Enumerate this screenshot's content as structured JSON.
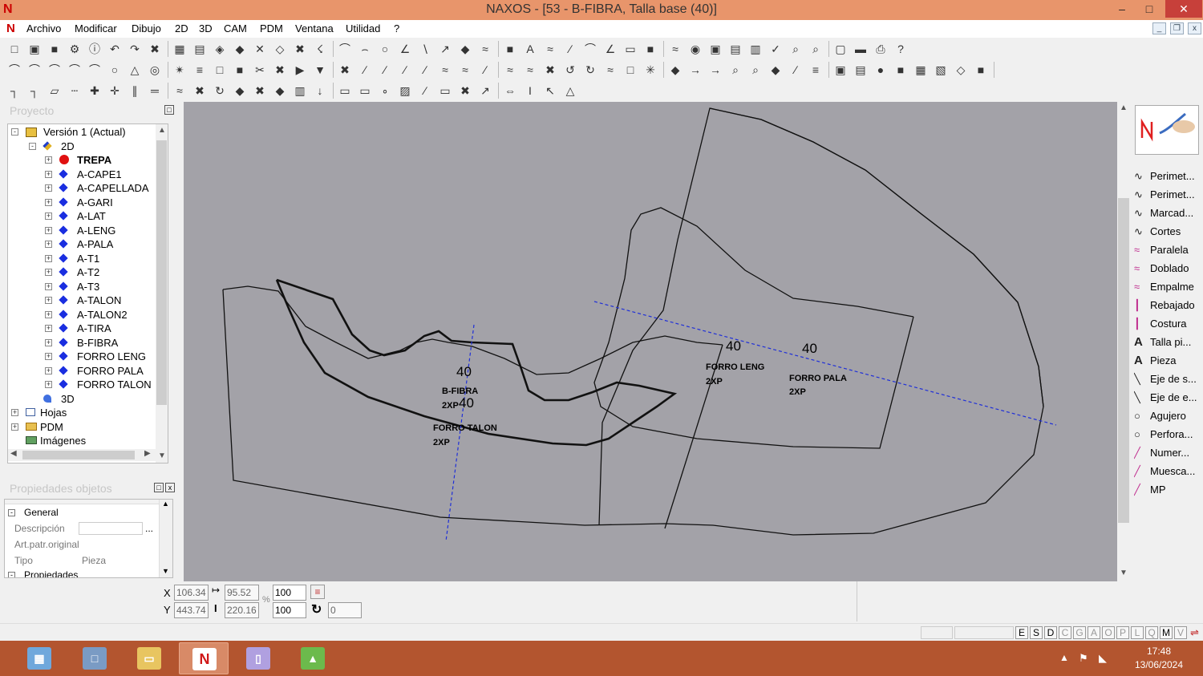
{
  "window": {
    "title": "NAXOS - [53 - B-FIBRA, Talla base (40)]",
    "minimize": "–",
    "maximize": "□",
    "close": "✕"
  },
  "menu": [
    "Archivo",
    "Modificar",
    "Dibujo",
    "2D",
    "3D",
    "CAM",
    "PDM",
    "Ventana",
    "Utilidad",
    "?"
  ],
  "project_panel": {
    "header": "Proyecto",
    "tree": [
      {
        "label": "Versión 1 (Actual)",
        "icon": "version-icon",
        "level": 0,
        "expander": "minus"
      },
      {
        "label": "2D",
        "icon": "2d-icon",
        "level": 1,
        "expander": "minus"
      },
      {
        "label": "TREPA",
        "icon": "red-dot",
        "level": 2,
        "expander": "plus",
        "bold": true
      },
      {
        "label": "A-CAPE1",
        "icon": "blue-diamond",
        "level": 2,
        "expander": "plus"
      },
      {
        "label": "A-CAPELLADA",
        "icon": "blue-diamond",
        "level": 2,
        "expander": "plus"
      },
      {
        "label": "A-GARI",
        "icon": "blue-diamond",
        "level": 2,
        "expander": "plus"
      },
      {
        "label": "A-LAT",
        "icon": "blue-diamond",
        "level": 2,
        "expander": "plus"
      },
      {
        "label": "A-LENG",
        "icon": "blue-diamond",
        "level": 2,
        "expander": "plus"
      },
      {
        "label": "A-PALA",
        "icon": "blue-diamond",
        "level": 2,
        "expander": "plus"
      },
      {
        "label": "A-T1",
        "icon": "blue-diamond",
        "level": 2,
        "expander": "plus"
      },
      {
        "label": "A-T2",
        "icon": "blue-diamond",
        "level": 2,
        "expander": "plus"
      },
      {
        "label": "A-T3",
        "icon": "blue-diamond",
        "level": 2,
        "expander": "plus"
      },
      {
        "label": "A-TALON",
        "icon": "blue-diamond",
        "level": 2,
        "expander": "plus"
      },
      {
        "label": "A-TALON2",
        "icon": "blue-diamond",
        "level": 2,
        "expander": "plus"
      },
      {
        "label": "A-TIRA",
        "icon": "blue-diamond",
        "level": 2,
        "expander": "plus"
      },
      {
        "label": "B-FIBRA",
        "icon": "blue-diamond",
        "level": 2,
        "expander": "plus"
      },
      {
        "label": "FORRO LENG",
        "icon": "blue-diamond",
        "level": 2,
        "expander": "plus"
      },
      {
        "label": "FORRO PALA",
        "icon": "blue-diamond",
        "level": 2,
        "expander": "plus"
      },
      {
        "label": "FORRO TALON",
        "icon": "blue-diamond",
        "level": 2,
        "expander": "plus"
      },
      {
        "label": "3D",
        "icon": "3d-icon",
        "level": 1,
        "expander": "none"
      },
      {
        "label": "Hojas",
        "icon": "sheets-icon",
        "level": 0,
        "expander": "plus"
      },
      {
        "label": "PDM",
        "icon": "folder-icon",
        "level": 0,
        "expander": "plus"
      },
      {
        "label": "Imágenes",
        "icon": "images-icon",
        "level": 0,
        "expander": "none"
      }
    ]
  },
  "properties_panel": {
    "header": "Propiedades objetos",
    "section_general": "General",
    "rows": [
      {
        "label": "Descripción",
        "value": "",
        "button": "..."
      },
      {
        "label": "Art.patr.original",
        "value": ""
      },
      {
        "label": "Tipo",
        "value": "Pieza"
      }
    ],
    "section_props": "Propiedades"
  },
  "canvas": {
    "labels": [
      {
        "text": "40",
        "kind": "size"
      },
      {
        "text": "B-FIBRA",
        "kind": "name"
      },
      {
        "text": "2XP",
        "kind": "qty"
      },
      {
        "text": "40",
        "kind": "size"
      },
      {
        "text": "FORRO TALON",
        "kind": "name"
      },
      {
        "text": "2XP",
        "kind": "qty"
      },
      {
        "text": "40",
        "kind": "size"
      },
      {
        "text": "FORRO LENG",
        "kind": "name"
      },
      {
        "text": "2XP",
        "kind": "qty"
      },
      {
        "text": "40",
        "kind": "size"
      },
      {
        "text": "FORRO PALA",
        "kind": "name"
      },
      {
        "text": "2XP",
        "kind": "qty"
      }
    ]
  },
  "right_panel": {
    "tools": [
      {
        "label": "Perimet...",
        "icon": "perimeter-icon"
      },
      {
        "label": "Perimet...",
        "icon": "perimeter-icon"
      },
      {
        "label": "Marcad...",
        "icon": "marker-icon"
      },
      {
        "label": "Cortes",
        "icon": "cut-icon"
      },
      {
        "label": "Paralela",
        "icon": "parallel-icon"
      },
      {
        "label": "Doblado",
        "icon": "fold-icon"
      },
      {
        "label": "Empalme",
        "icon": "join-icon"
      },
      {
        "label": "Rebajado",
        "icon": "skive-icon"
      },
      {
        "label": "Costura",
        "icon": "seam-icon"
      },
      {
        "label": "Talla pi...",
        "icon": "text-a-icon"
      },
      {
        "label": "Pieza",
        "icon": "text-a-icon"
      },
      {
        "label": "Eje de s...",
        "icon": "axis-icon"
      },
      {
        "label": "Eje de e...",
        "icon": "axis-icon"
      },
      {
        "label": "Agujero",
        "icon": "circle-icon"
      },
      {
        "label": "Perfora...",
        "icon": "circle-icon"
      },
      {
        "label": "Numer...",
        "icon": "numbering-icon"
      },
      {
        "label": "Muesca...",
        "icon": "notch-icon"
      },
      {
        "label": "MP",
        "icon": "mp-icon"
      }
    ]
  },
  "status": {
    "x_label": "X",
    "y_label": "Y",
    "x_value": "106.34",
    "y_value": "443.74",
    "width_value": "95.52",
    "height_value": "220.16",
    "percent_symbol": "%",
    "scale_x": "100",
    "scale_y": "100",
    "rotation": "0",
    "flags": [
      "E",
      "S",
      "D",
      "C",
      "G",
      "A",
      "O",
      "P",
      "L",
      "Q",
      "M",
      "V"
    ]
  },
  "taskbar": {
    "time": "17:48",
    "date": "13/06/2024"
  },
  "colors": {
    "titlebar": "#e8956b",
    "canvas": "#a3a2a8",
    "taskbar": "#b3552f",
    "axis_line": "#1f2fd8",
    "tree_diamond": "#1a2ee0",
    "tree_red": "#e01010"
  }
}
